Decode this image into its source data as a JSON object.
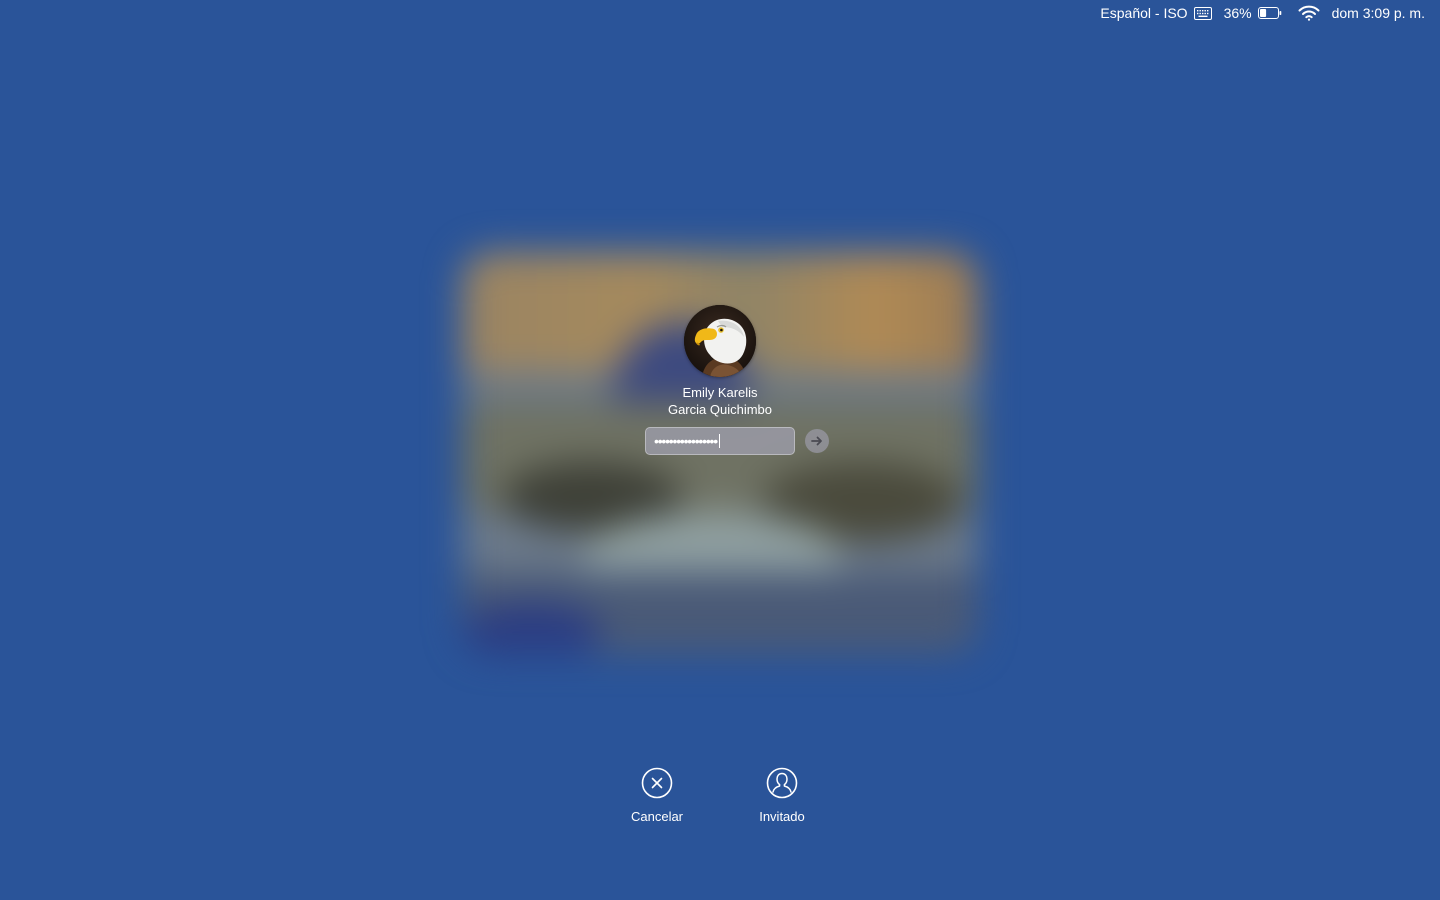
{
  "menubar": {
    "keyboard_layout": "Español - ISO",
    "battery_percent": "36%",
    "battery_level": 0.36,
    "clock": "dom 3:09 p. m.",
    "icons": [
      "keyboard-icon",
      "battery-icon",
      "wifi-icon"
    ]
  },
  "user": {
    "name_line1": "Emily Karelis",
    "name_line2": "Garcia Quichimbo",
    "avatar": "eagle-avatar"
  },
  "password": {
    "masked_value": "•••••••••••••••••"
  },
  "actions": {
    "cancel_label": "Cancelar",
    "guest_label": "Invitado"
  },
  "colors": {
    "background": "#2a5499",
    "text": "#ffffff"
  }
}
